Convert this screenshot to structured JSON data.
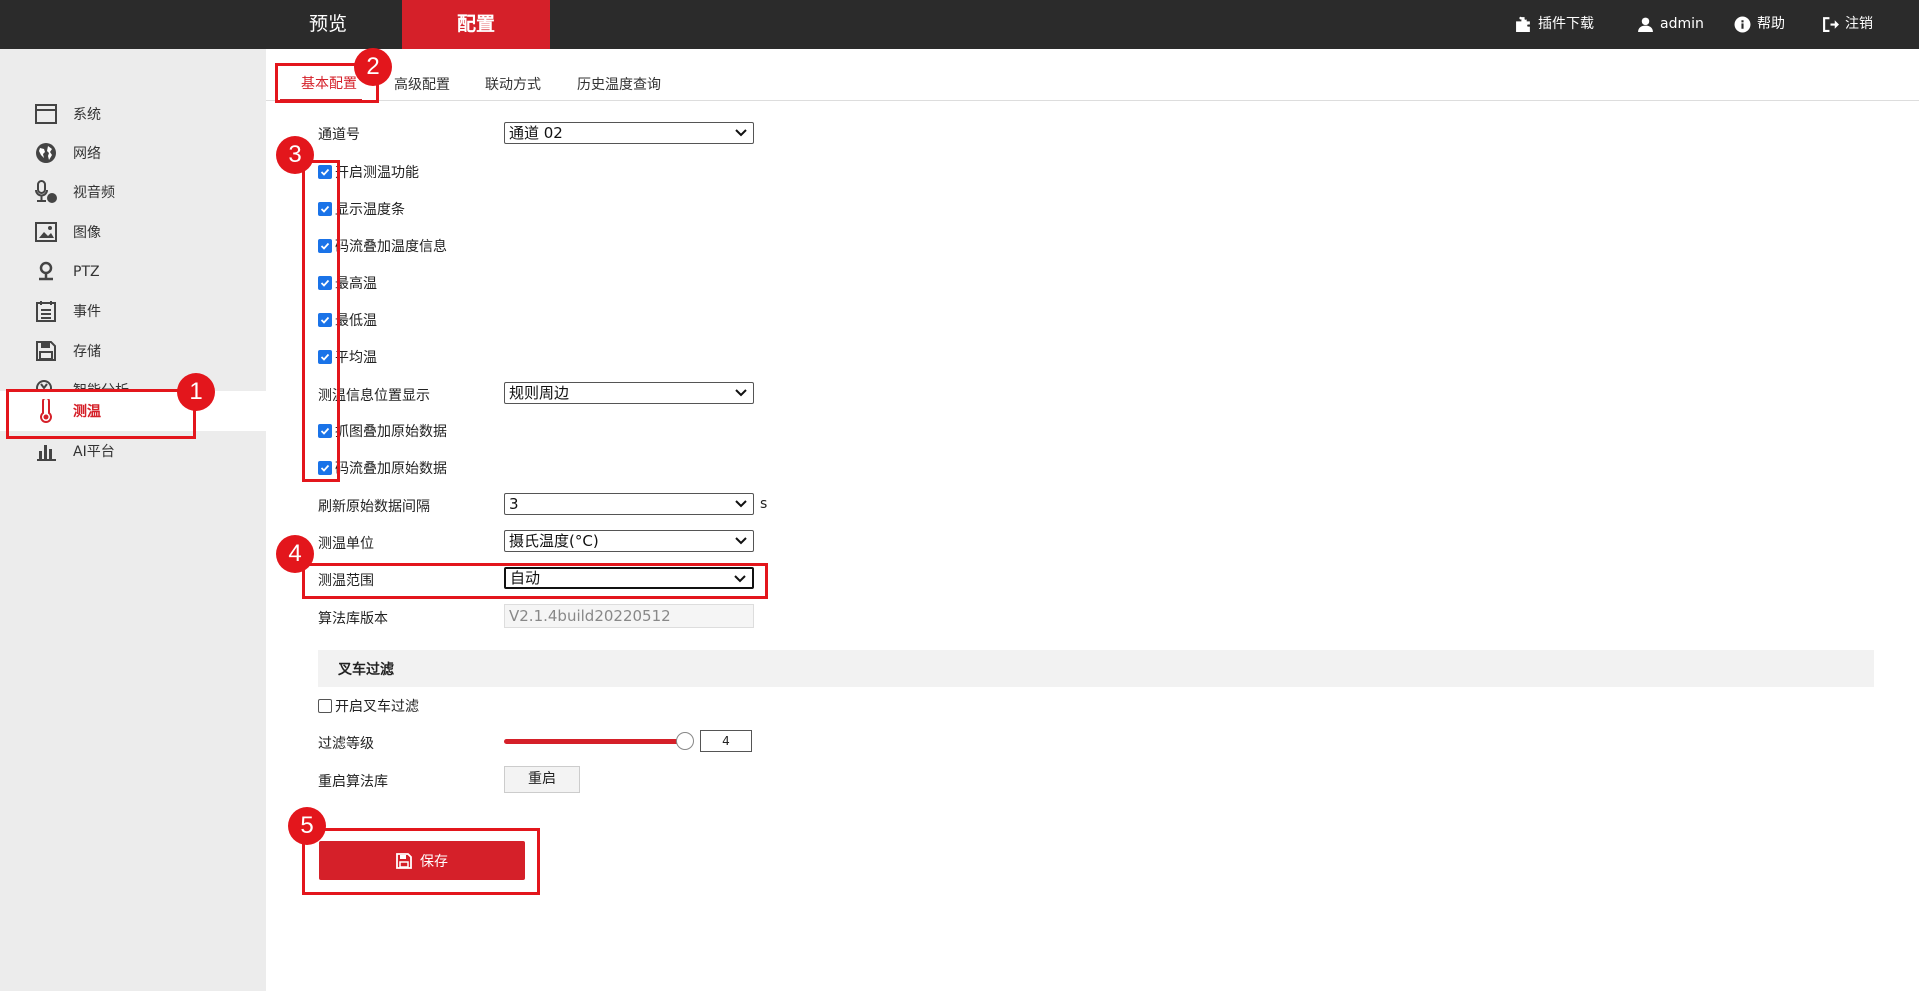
{
  "topbar": {
    "nav": [
      "预览",
      "配置"
    ],
    "right": {
      "plugin": "插件下载",
      "user": "admin",
      "help": "帮助",
      "logout": "注销"
    }
  },
  "sidebar": {
    "items": [
      {
        "label": "系统",
        "icon": "window-icon"
      },
      {
        "label": "网络",
        "icon": "globe-icon"
      },
      {
        "label": "视音频",
        "icon": "microphone-icon"
      },
      {
        "label": "图像",
        "icon": "image-icon"
      },
      {
        "label": "PTZ",
        "icon": "ptz-icon"
      },
      {
        "label": "事件",
        "icon": "calendar-icon"
      },
      {
        "label": "存储",
        "icon": "save-icon"
      },
      {
        "label": "智能分析",
        "icon": "analysis-icon"
      },
      {
        "label": "测温",
        "icon": "thermometer-icon"
      },
      {
        "label": "AI平台",
        "icon": "bar-chart-icon"
      }
    ]
  },
  "tabs": [
    "基本配置",
    "高级配置",
    "联动方式",
    "历史温度查询"
  ],
  "form": {
    "channel_label": "通道号",
    "channel_value": "通道 02",
    "checkboxes": [
      "开启测温功能",
      "显示温度条",
      "码流叠加温度信息",
      "最高温",
      "最低温",
      "平均温"
    ],
    "info_pos_label": "测温信息位置显示",
    "info_pos_value": "规则周边",
    "checkboxes2": [
      "抓图叠加原始数据",
      "码流叠加原始数据"
    ],
    "refresh_label": "刷新原始数据间隔",
    "refresh_value": "3",
    "refresh_unit": "s",
    "unit_label": "测温单位",
    "unit_value": "摄氏温度(°C)",
    "range_label": "测温范围",
    "range_value": "自动",
    "algo_label": "算法库版本",
    "algo_value": "V2.1.4build20220512"
  },
  "forklift": {
    "section_title": "叉车过滤",
    "enable_label": "开启叉车过滤",
    "level_label": "过滤等级",
    "level_value": "4",
    "level_fraction": 1.0,
    "restart_label": "重启算法库",
    "restart_button": "重启"
  },
  "save_button": "保存",
  "annotations": [
    "1",
    "2",
    "3",
    "4",
    "5"
  ],
  "colors": {
    "accent": "#d52029",
    "annotation": "#e3161c",
    "checkbox": "#1a73e8"
  }
}
